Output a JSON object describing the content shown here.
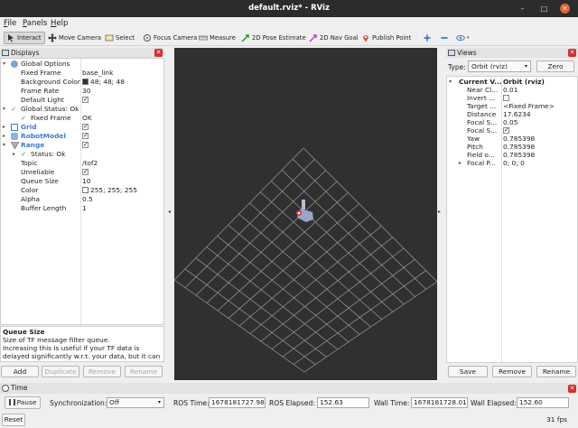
{
  "window": {
    "title": "default.rviz* - RViz"
  },
  "menu": [
    {
      "label": "File",
      "mnemonic": "F",
      "rest": "ile"
    },
    {
      "label": "Panels",
      "mnemonic": "P",
      "rest": "anels"
    },
    {
      "label": "Help",
      "mnemonic": "H",
      "rest": "elp"
    }
  ],
  "toolbar": {
    "interact": "Interact",
    "move_camera": "Move Camera",
    "select": "Select",
    "focus_camera": "Focus Camera",
    "measure": "Measure",
    "pose_estimate": "2D Pose Estimate",
    "nav_goal": "2D Nav Goal",
    "publish_point": "Publish Point"
  },
  "displays": {
    "title": "Displays",
    "tree": {
      "global_options": "Global Options",
      "fixed_frame_k": "Fixed Frame",
      "fixed_frame_v": "base_link",
      "bg_color_k": "Background Color",
      "bg_color_v": "48; 48; 48",
      "frame_rate_k": "Frame Rate",
      "frame_rate_v": "30",
      "default_light_k": "Default Light",
      "global_status": "Global Status: Ok",
      "gs_fixed_frame_k": "Fixed Frame",
      "gs_fixed_frame_v": "OK",
      "grid": "Grid",
      "robot_model": "RobotModel",
      "range": "Range",
      "range_status": "Status: Ok",
      "topic_k": "Topic",
      "topic_v": "/tof2",
      "unreliable_k": "Unreliable",
      "queue_size_k": "Queue Size",
      "queue_size_v": "10",
      "color_k": "Color",
      "color_v": "255; 255; 255",
      "alpha_k": "Alpha",
      "alpha_v": "0.5",
      "buffer_length_k": "Buffer Length",
      "buffer_length_v": "1"
    },
    "help": {
      "heading": "Queue Size",
      "line1": "Size of TF message filter queue.",
      "line2": "Increasing this is useful if your TF data is",
      "line3": "delayed significantly w.r.t. your data, but it can"
    },
    "buttons": {
      "add": "Add",
      "duplicate": "Duplicate",
      "remove": "Remove",
      "rename": "Rename"
    }
  },
  "views": {
    "title": "Views",
    "type_label": "Type:",
    "type_value": "Orbit (rviz)",
    "zero": "Zero",
    "tree": {
      "current_k": "Current V...",
      "current_v": "Orbit (rviz)",
      "near_k": "Near Cl...",
      "near_v": "0.01",
      "invert_k": "Invert ...",
      "target_k": "Target ...",
      "target_v": "<Fixed Frame>",
      "distance_k": "Distance",
      "distance_v": "17.6234",
      "focal_s1_k": "Focal S...",
      "focal_s1_v": "0.05",
      "focal_s2_k": "Focal S...",
      "yaw_k": "Yaw",
      "yaw_v": "0.785398",
      "pitch_k": "Pitch",
      "pitch_v": "0.785398",
      "field_k": "Field o...",
      "field_v": "0.785398",
      "focal_p_k": "Focal P...",
      "focal_p_v": "0; 0; 0"
    },
    "buttons": {
      "save": "Save",
      "remove": "Remove",
      "rename": "Rename"
    }
  },
  "time": {
    "title": "Time",
    "pause": "Pause",
    "sync_label": "Synchronization:",
    "sync_value": "Off",
    "ros_time_label": "ROS Time:",
    "ros_time": "1678181727.98",
    "ros_elapsed_label": "ROS Elapsed:",
    "ros_elapsed": "152.63",
    "wall_time_label": "Wall Time:",
    "wall_time": "1678181728.01",
    "wall_elapsed_label": "Wall Elapsed:",
    "wall_elapsed": "152.60"
  },
  "status": {
    "reset": "Reset",
    "fps": "31 fps"
  },
  "colors": {
    "accent": "#3a7bd5",
    "close": "#d32f2f",
    "viewport_bg": "#303030",
    "ok_green": "#2a9d2a"
  },
  "icons": [
    "rviz-icon",
    "interact-icon",
    "move-camera-icon",
    "select-icon",
    "focus-camera-icon",
    "measure-icon",
    "pose-estimate-icon",
    "nav-goal-icon",
    "publish-point-icon",
    "plus-icon",
    "minus-icon",
    "eye-icon"
  ]
}
